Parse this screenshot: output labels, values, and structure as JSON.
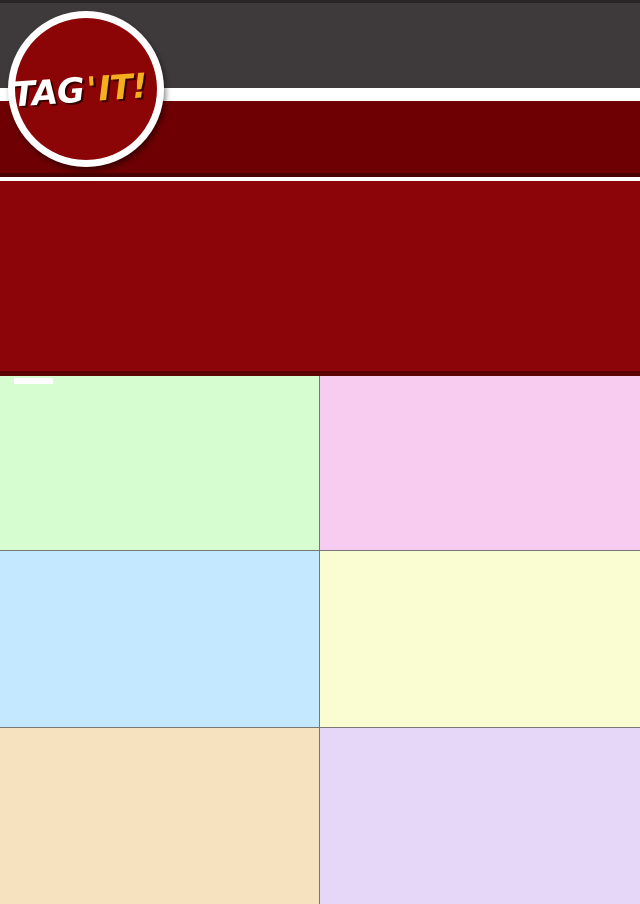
{
  "logo": {
    "tag_text": "TAG",
    "apostrophe": "'",
    "it_text": "IT!"
  },
  "colors": {
    "topbar": "#3e393a",
    "nav_bar": "#6e0003",
    "banner": "#8c0609",
    "logo_red": "#8b0406",
    "logo_accent": "#f2b01e"
  },
  "tiles": [
    {
      "color": "#d5fdd0"
    },
    {
      "color": "#f8ccf1"
    },
    {
      "color": "#c4e8ff"
    },
    {
      "color": "#f9fdd1"
    },
    {
      "color": "#f7e2bf"
    },
    {
      "color": "#e6d6f8"
    }
  ]
}
